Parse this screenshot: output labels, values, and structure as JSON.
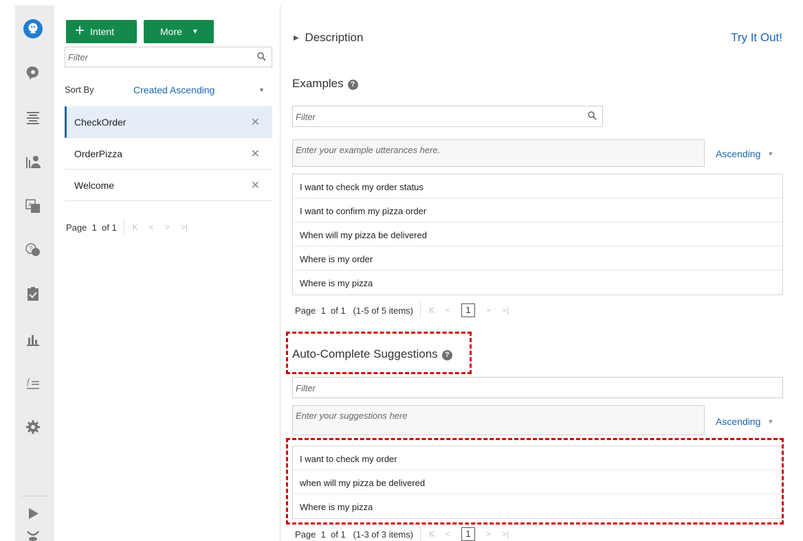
{
  "rail": {
    "icons": [
      "bot-avatar-icon",
      "intents-icon",
      "entities-icon",
      "flows-icon",
      "translation-icon",
      "qna-icon",
      "quality-icon",
      "insights-icon",
      "functions-icon",
      "settings-icon",
      "run-icon",
      "debug-icon"
    ]
  },
  "intents": {
    "add_button_plus": "+",
    "add_button_label": "Intent",
    "more_button_label": "More",
    "more_caret": "▼",
    "filter_placeholder": "Filter",
    "sort_by_label": "Sort By",
    "sort_value": "Created Ascending",
    "sort_caret": "▼",
    "items": [
      {
        "label": "CheckOrder",
        "close": "✕"
      },
      {
        "label": "OrderPizza",
        "close": "✕"
      },
      {
        "label": "Welcome",
        "close": "✕"
      }
    ],
    "pager": {
      "text": "Page  1  of 1",
      "first": "K",
      "prev": "<",
      "next": ">",
      "last": ">|"
    }
  },
  "main": {
    "description_toggle_arrow": "▶",
    "description_label": "Description",
    "try_it_label": "Try It Out!",
    "examples": {
      "title": "Examples",
      "help": "?",
      "filter_placeholder": "Filter",
      "entry_placeholder": "Enter your example utterances here.",
      "order_label": "Ascending",
      "order_caret": "▼",
      "rows": [
        "I want to check my order status",
        "I want to confirm my pizza order",
        "When will my pizza be delivered",
        "Where is my order",
        "Where is my pizza"
      ],
      "pager_text": "Page  1  of 1   (1-5 of 5 items)",
      "pager_first": "K",
      "pager_prev": "<",
      "pager_current": "1",
      "pager_next": ">",
      "pager_last": ">|"
    },
    "suggestions": {
      "title": "Auto-Complete Suggestions",
      "help": "?",
      "filter_placeholder": "Filter",
      "entry_placeholder": "Enter your suggestions here",
      "order_label": "Ascending",
      "order_caret": "▼",
      "rows": [
        "I want to check my order",
        "when will my pizza be delivered",
        "Where is my pizza"
      ],
      "pager_text": "Page  1  of 1   (1-3 of 3 items)",
      "pager_first": "K",
      "pager_prev": "<",
      "pager_current": "1",
      "pager_next": ">",
      "pager_last": ">|"
    }
  },
  "colors": {
    "accent": "#1a66b0",
    "primary_button": "#138a4b",
    "highlight": "#d20000"
  }
}
